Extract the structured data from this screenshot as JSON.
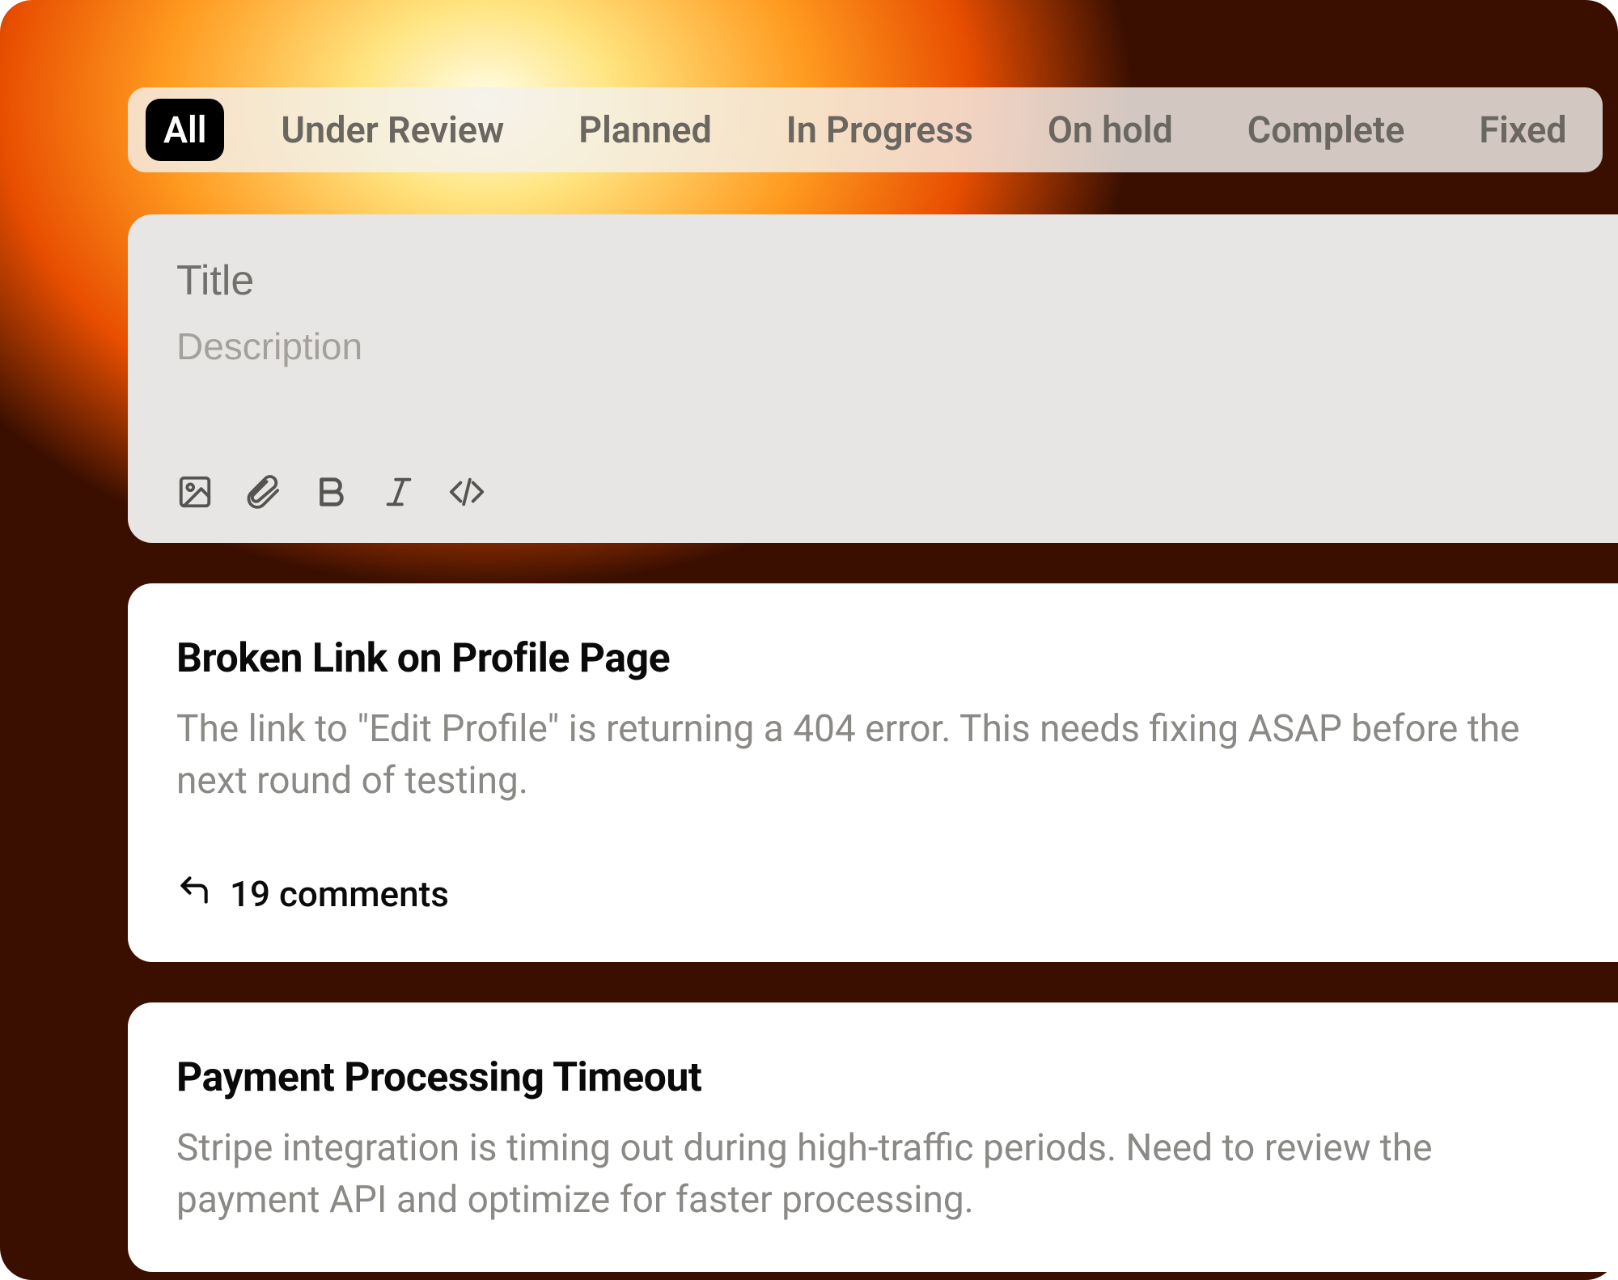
{
  "tabs": [
    {
      "label": "All",
      "active": true
    },
    {
      "label": "Under Review",
      "active": false
    },
    {
      "label": "Planned",
      "active": false
    },
    {
      "label": "In Progress",
      "active": false
    },
    {
      "label": "On hold",
      "active": false
    },
    {
      "label": "Complete",
      "active": false
    },
    {
      "label": "Fixed",
      "active": false
    }
  ],
  "composer": {
    "title_placeholder": "Title",
    "description_placeholder": "Description"
  },
  "cards": [
    {
      "title": "Broken Link on Profile Page",
      "description": "The link to \"Edit Profile\" is returning a 404 error. This needs fixing ASAP before the next round of testing.",
      "comments_label": "19 comments"
    },
    {
      "title": "Payment Processing Timeout",
      "description": "Stripe integration is timing out during high-traffic periods. Need to review the payment API and optimize for faster processing."
    }
  ]
}
